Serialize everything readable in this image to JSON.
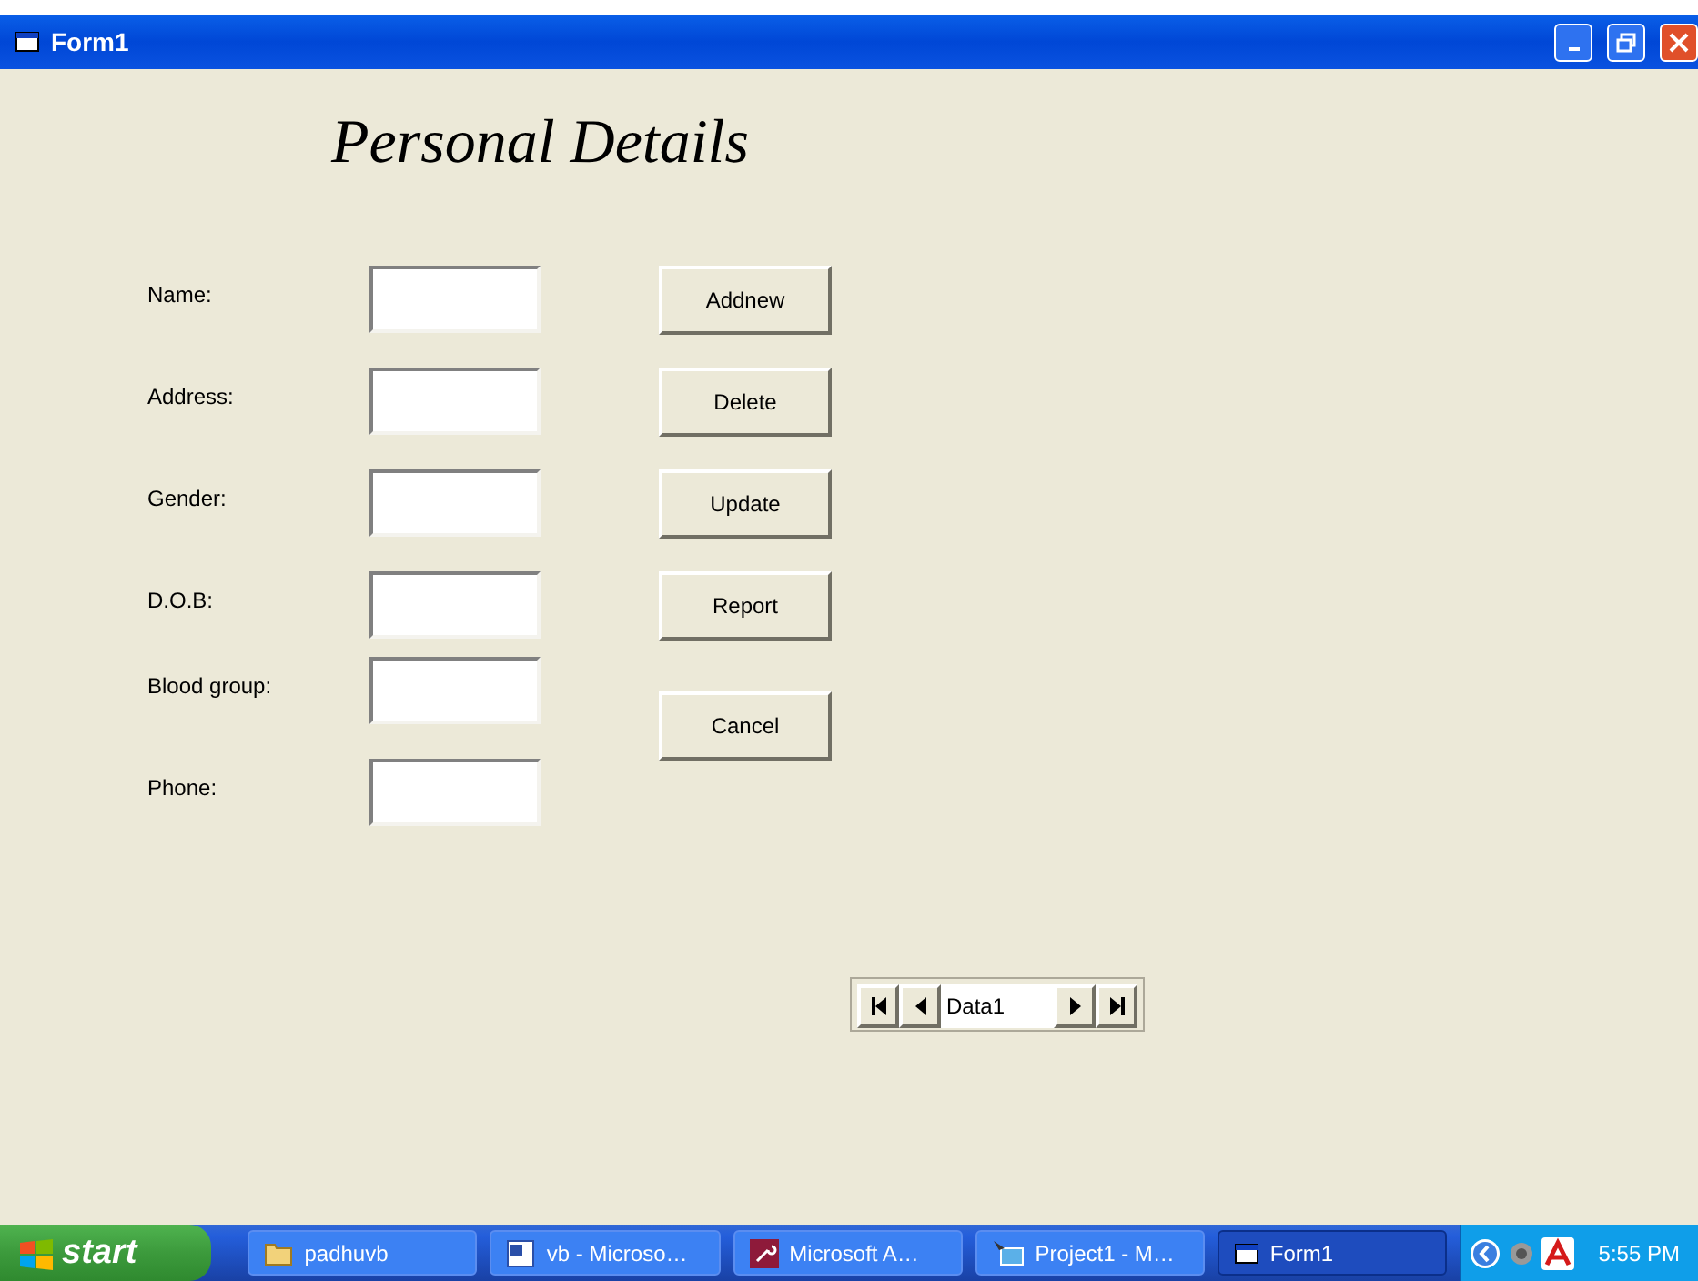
{
  "window": {
    "title": "Form1"
  },
  "heading": "Personal Details",
  "fields": [
    {
      "label": "Name:"
    },
    {
      "label": "Address:"
    },
    {
      "label": "Gender:"
    },
    {
      "label": "D.O.B:"
    },
    {
      "label": "Blood group:"
    },
    {
      "label": "Phone:"
    }
  ],
  "buttons": [
    "Addnew",
    "Delete",
    "Update",
    "Report",
    "Cancel"
  ],
  "data_control": {
    "caption": "Data1"
  },
  "taskbar": {
    "start": "start",
    "items": [
      {
        "label": "padhuvb",
        "selected": false
      },
      {
        "label": "vb - Microso…",
        "selected": false
      },
      {
        "label": "Microsoft A…",
        "selected": false
      },
      {
        "label": "Project1 - M…",
        "selected": false
      },
      {
        "label": "Form1",
        "selected": true
      }
    ],
    "clock": "5:55 PM"
  }
}
